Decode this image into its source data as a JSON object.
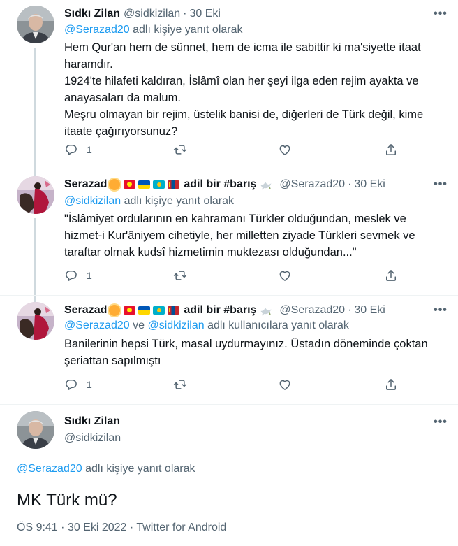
{
  "tweets": [
    {
      "name": "Sıdkı Zilan",
      "handle": "@sidkizilan",
      "time": "30 Eki",
      "reply_mention": "@Serazad20",
      "reply_suffix": "adlı kişiye yanıt olarak",
      "lines": [
        "Hem Qur'an hem de sünnet, hem de icma ile sabittir ki ma'siyette itaat haramdır.",
        "1924'te hilafeti kaldıran, İslâmî olan her şeyi ilga eden rejim ayakta ve anayasaları da malum.",
        "Meşru olmayan bir rejim, üstelik banisi de, diğerleri de Türk değil, kime itaate çağırıyorsunuz?"
      ],
      "reply_count": "1"
    },
    {
      "name": "Serazad",
      "name_suffix": "adil bir #barış",
      "handle": "@Serazad20",
      "time": "30 Eki",
      "reply_mention": "@sidkizilan",
      "reply_suffix": "adlı kişiye yanıt olarak",
      "lines": [
        "\"İslâmiyet ordularının en kahramanı Türkler olduğundan, meslek ve hizmet-i Kur'âniyem cihetiyle, her milletten ziyade Türkleri sevmek ve taraftar olmak kudsî hizmetimin muktezası olduğundan...\""
      ],
      "reply_count": "1"
    },
    {
      "name": "Serazad",
      "name_suffix": "adil bir #barış",
      "handle": "@Serazad20",
      "time": "30 Eki",
      "reply_mention_1": "@Serazad20",
      "reply_and": "ve",
      "reply_mention_2": "@sidkizilan",
      "reply_suffix": "adlı kullanıcılara yanıt olarak",
      "lines": [
        "Banilerinin hepsi Türk, masal uydurmayınız. Üstadın döneminde çoktan şeriattan sapılmıştı"
      ],
      "reply_count": "1"
    }
  ],
  "main_tweet": {
    "name": "Sıdkı Zilan",
    "handle": "@sidkizilan",
    "reply_mention": "@Serazad20",
    "reply_suffix": "adlı kişiye yanıt olarak",
    "text": "MK Türk mü?",
    "meta": "ÖS 9:41 · 30 Eki 2022 · Twitter for Android"
  },
  "icons": {
    "reply": "reply-icon",
    "retweet": "retweet-icon",
    "like": "heart-icon",
    "share": "share-icon",
    "more": "more-icon"
  },
  "colors": {
    "link": "#1d9bf0",
    "secondary": "#536471",
    "text": "#0f1419",
    "line": "#cfd9de"
  }
}
